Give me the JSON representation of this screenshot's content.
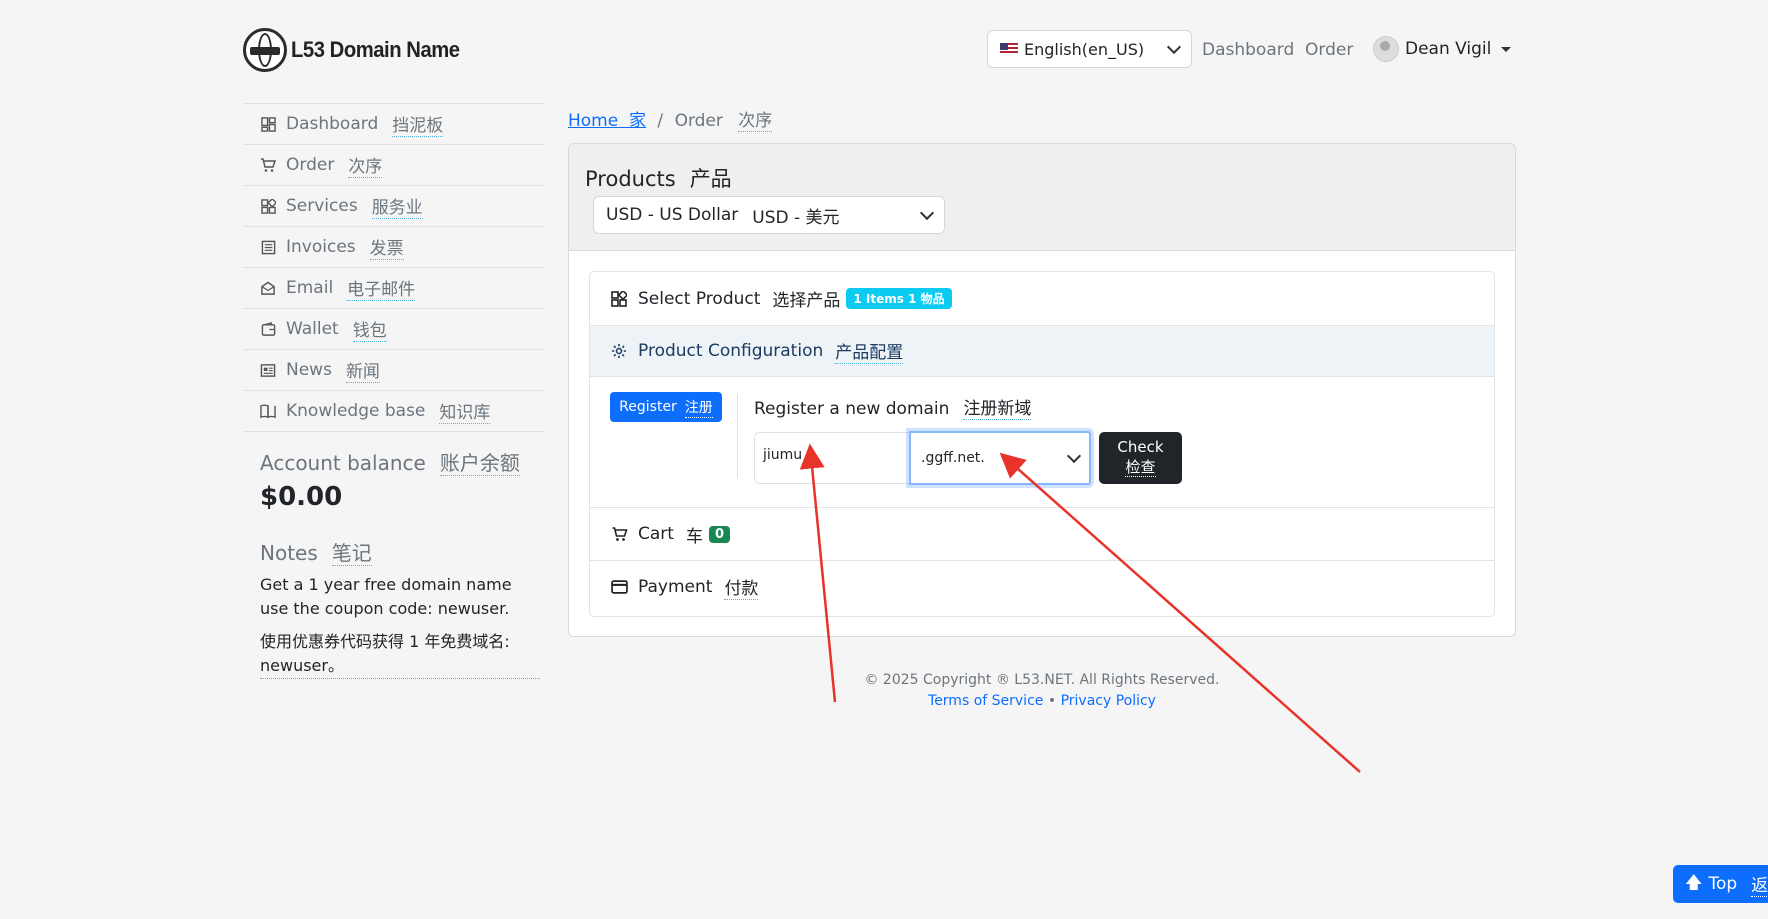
{
  "header": {
    "brand": "L53 Domain Name",
    "language": "English(en_US)",
    "nav_dashboard": "Dashboard",
    "nav_order": "Order",
    "user_name": "Dean Vigil"
  },
  "sidebar": {
    "items": [
      {
        "label": "Dashboard",
        "zh": "挡泥板",
        "icon": "dashboard-icon"
      },
      {
        "label": "Order",
        "zh": "次序",
        "icon": "cart-icon"
      },
      {
        "label": "Services",
        "zh": "服务业",
        "icon": "grid-icon"
      },
      {
        "label": "Invoices",
        "zh": "发票",
        "icon": "invoice-icon"
      },
      {
        "label": "Email",
        "zh": "电子邮件",
        "icon": "envelope-icon"
      },
      {
        "label": "Wallet",
        "zh": "钱包",
        "icon": "wallet-icon"
      },
      {
        "label": "News",
        "zh": "新闻",
        "icon": "newspaper-icon"
      },
      {
        "label": "Knowledge base",
        "zh": "知识库",
        "icon": "book-icon"
      }
    ],
    "balance_title": "Account balance",
    "balance_title_zh": "账户余额",
    "balance": "$0.00",
    "notes_title": "Notes",
    "notes_title_zh": "笔记",
    "notes_text": "Get a 1 year free domain name use the coupon code: newuser.",
    "notes_text_zh": "使用优惠券代码获得 1 年免费域名: newuser。"
  },
  "breadcrumb": {
    "home": "Home",
    "home_zh": "家",
    "current": "Order",
    "current_zh": "次序"
  },
  "products": {
    "title": "Products",
    "title_zh": "产品",
    "currency": "USD - US Dollar",
    "currency_zh": "USD - 美元",
    "select_product": "Select Product",
    "select_product_zh": "选择产品",
    "items_badge": "1 Items  1 物品",
    "product_config": "Product Configuration",
    "product_config_zh": "产品配置",
    "register_btn": "Register",
    "register_btn_zh": "注册",
    "register_title": "Register a new domain",
    "register_title_zh": "注册新域",
    "domain_value": "jiumu",
    "tld_value": ".ggff.net.",
    "check_btn": "Check",
    "check_btn_zh": "检查",
    "cart": "Cart",
    "cart_zh": "车",
    "cart_count": "0",
    "payment": "Payment",
    "payment_zh": "付款"
  },
  "footer": {
    "copyright": "© 2025 Copyright ® L53.NET. All Rights Reserved.",
    "terms": "Terms of Service",
    "privacy": "Privacy Policy"
  },
  "top_button": {
    "label": "Top",
    "zh": "返回"
  },
  "colors": {
    "primary": "#0d6efd",
    "info_badge": "#0dcaf0",
    "success_badge": "#198754",
    "annotation_arrow": "#e8332a"
  }
}
